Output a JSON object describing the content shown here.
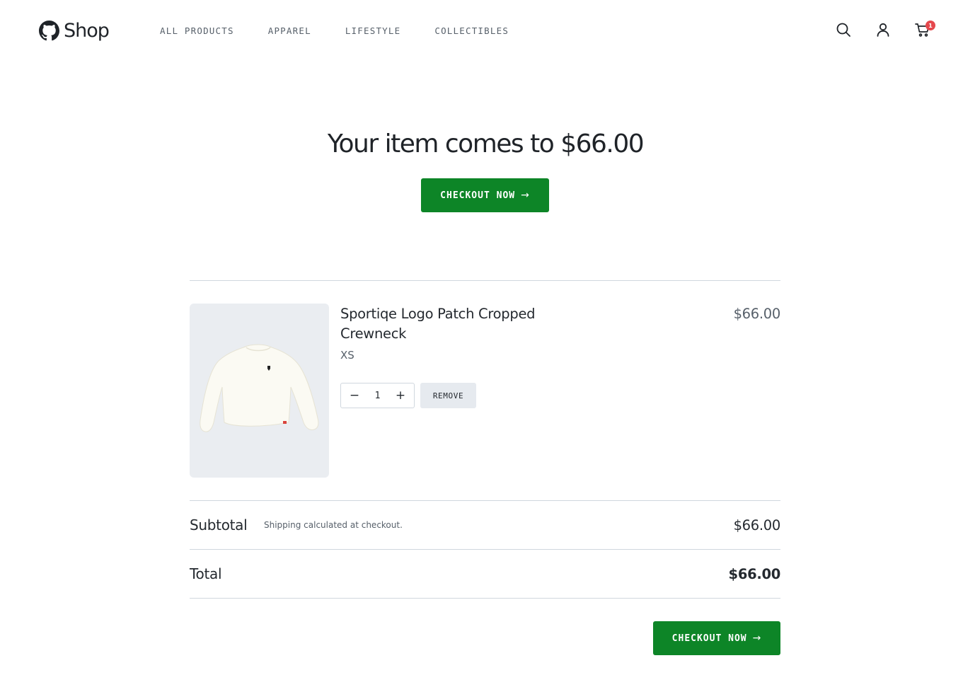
{
  "brand": {
    "name": "Shop",
    "logo_icon": "github-mark-icon"
  },
  "nav": [
    {
      "label": "ALL PRODUCTS"
    },
    {
      "label": "APPAREL"
    },
    {
      "label": "LIFESTYLE"
    },
    {
      "label": "COLLECTIBLES"
    }
  ],
  "header_icons": {
    "search": "search-icon",
    "account": "user-icon",
    "cart": "cart-icon",
    "cart_count": "1"
  },
  "hero": {
    "title": "Your item comes to $66.00",
    "checkout_label": "CHECKOUT NOW",
    "arrow": "→"
  },
  "cart_item": {
    "name": "Sportiqe Logo Patch Cropped Crewneck",
    "variant": "XS",
    "price": "$66.00",
    "quantity": "1",
    "decrement": "−",
    "increment": "+",
    "remove_label": "REMOVE"
  },
  "summary": {
    "subtotal_label": "Subtotal",
    "shipping_note": "Shipping calculated at checkout.",
    "subtotal_value": "$66.00",
    "total_label": "Total",
    "total_value": "$66.00"
  },
  "footer_checkout": {
    "label": "CHECKOUT NOW",
    "arrow": "→"
  },
  "colors": {
    "accent": "#0d8527",
    "badge": "#e5484d",
    "image_bg": "#eaedf1"
  }
}
